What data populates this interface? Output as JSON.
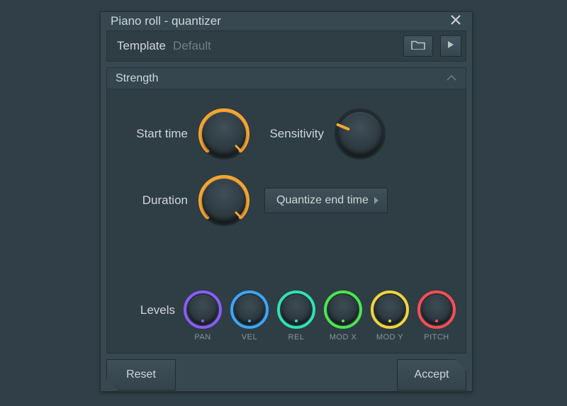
{
  "window": {
    "title": "Piano roll - quantizer"
  },
  "template": {
    "label": "Template",
    "value": "Default"
  },
  "section": {
    "title": "Strength"
  },
  "knobs": {
    "start_time": {
      "label": "Start time",
      "angle_deg": 100,
      "color": "#f6a531"
    },
    "sensitivity": {
      "label": "Sensitivity",
      "angle_deg": 25,
      "color": "#f6a531"
    },
    "duration": {
      "label": "Duration",
      "angle_deg": 100,
      "color": "#f6a531"
    }
  },
  "quantize_mode": {
    "label": "Quantize end time"
  },
  "levels": {
    "label": "Levels",
    "items": [
      {
        "id": "pan",
        "label": "PAN",
        "color": "#8a5cff"
      },
      {
        "id": "vel",
        "label": "VEL",
        "color": "#3aa7ff"
      },
      {
        "id": "rel",
        "label": "REL",
        "color": "#2fe2b6"
      },
      {
        "id": "modx",
        "label": "MOD X",
        "color": "#49e84e"
      },
      {
        "id": "mody",
        "label": "MOD Y",
        "color": "#f2d53c"
      },
      {
        "id": "pitch",
        "label": "PITCH",
        "color": "#ff4d57"
      }
    ]
  },
  "buttons": {
    "reset": "Reset",
    "accept": "Accept"
  },
  "icons": {
    "close": "close-icon",
    "folder": "folder-icon",
    "play": "play-icon",
    "chevron": "chevron-up-icon"
  }
}
